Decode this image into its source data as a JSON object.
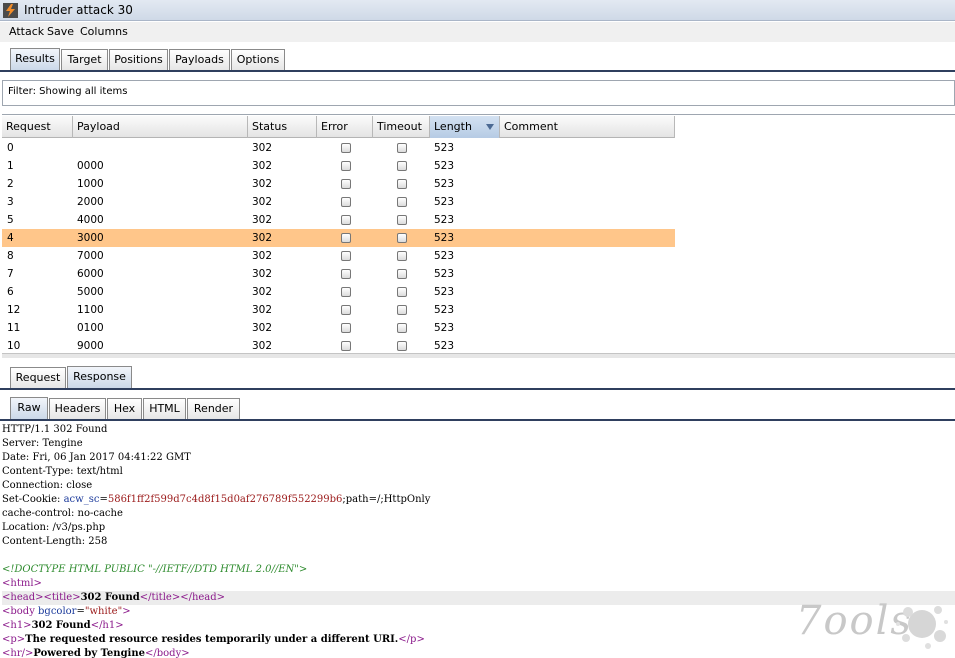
{
  "window": {
    "title": "Intruder attack 30"
  },
  "menu": [
    "Attack",
    "Save",
    "Columns"
  ],
  "main_tabs": [
    "Results",
    "Target",
    "Positions",
    "Payloads",
    "Options"
  ],
  "filter": {
    "text": "Filter:  Showing all items"
  },
  "table": {
    "columns": [
      "Request",
      "Payload",
      "Status",
      "Error",
      "Timeout",
      "Length",
      "Comment"
    ],
    "sorted_column": "Length",
    "rows": [
      {
        "request": "0",
        "payload": "",
        "status": "302",
        "error": false,
        "timeout": false,
        "length": "523",
        "comment": ""
      },
      {
        "request": "1",
        "payload": "0000",
        "status": "302",
        "error": false,
        "timeout": false,
        "length": "523",
        "comment": ""
      },
      {
        "request": "2",
        "payload": "1000",
        "status": "302",
        "error": false,
        "timeout": false,
        "length": "523",
        "comment": ""
      },
      {
        "request": "3",
        "payload": "2000",
        "status": "302",
        "error": false,
        "timeout": false,
        "length": "523",
        "comment": ""
      },
      {
        "request": "5",
        "payload": "4000",
        "status": "302",
        "error": false,
        "timeout": false,
        "length": "523",
        "comment": ""
      },
      {
        "request": "4",
        "payload": "3000",
        "status": "302",
        "error": false,
        "timeout": false,
        "length": "523",
        "comment": "",
        "selected": true
      },
      {
        "request": "8",
        "payload": "7000",
        "status": "302",
        "error": false,
        "timeout": false,
        "length": "523",
        "comment": ""
      },
      {
        "request": "7",
        "payload": "6000",
        "status": "302",
        "error": false,
        "timeout": false,
        "length": "523",
        "comment": ""
      },
      {
        "request": "6",
        "payload": "5000",
        "status": "302",
        "error": false,
        "timeout": false,
        "length": "523",
        "comment": ""
      },
      {
        "request": "12",
        "payload": "1100",
        "status": "302",
        "error": false,
        "timeout": false,
        "length": "523",
        "comment": ""
      },
      {
        "request": "11",
        "payload": "0100",
        "status": "302",
        "error": false,
        "timeout": false,
        "length": "523",
        "comment": ""
      },
      {
        "request": "10",
        "payload": "9000",
        "status": "302",
        "error": false,
        "timeout": false,
        "length": "523",
        "comment": ""
      }
    ]
  },
  "message_tabs": [
    "Request",
    "Response"
  ],
  "view_tabs": [
    "Raw",
    "Headers",
    "Hex",
    "HTML",
    "Render"
  ],
  "response": {
    "status_line": "HTTP/1.1 302 Found",
    "server": "Server: Tengine",
    "date": "Date: Fri, 06 Jan 2017 04:41:22 GMT",
    "content_type": "Content-Type: text/html",
    "connection": "Connection: close",
    "set_cookie_prefix": "Set-Cookie: ",
    "set_cookie_name": "acw_sc",
    "set_cookie_eq": "=",
    "set_cookie_value": "586f1ff2f599d7c4d8f15d0af276789f552299b6",
    "set_cookie_suffix": ";path=/;HttpOnly",
    "cache_control": "cache-control: no-cache",
    "location": "Location: /v3/ps.php",
    "content_length": "Content-Length: 258",
    "doctype": "<!DOCTYPE HTML PUBLIC \"-//IETF//DTD HTML 2.0//EN\">",
    "html_open": "<html>",
    "head_open": "<head>",
    "title_open": "<title>",
    "title_text": "302 Found",
    "title_close": "</title>",
    "head_close": "</head>",
    "body_open_start": "<body ",
    "body_attr": "bgcolor",
    "body_eq": "=",
    "body_attr_val": "\"white\"",
    "body_open_end": ">",
    "h1_open": "<h1>",
    "h1_text": "302 Found",
    "h1_close": "</h1>",
    "p_open": "<p>",
    "p_text": "The requested resource resides temporarily under a different URI.",
    "p_close": "</p>",
    "hr_tag": "<hr/>",
    "powered_text": "Powered by Tengine",
    "body_close": "</body>"
  },
  "watermark": {
    "text": "7ools"
  },
  "colors": {
    "selected_row": "#ffc68a",
    "tab_line": "#2f3f5e",
    "tag": "#8b1a8b",
    "attr": "#1b3a9b",
    "value": "#9b1a1a",
    "doctype": "#2e8b2e"
  }
}
